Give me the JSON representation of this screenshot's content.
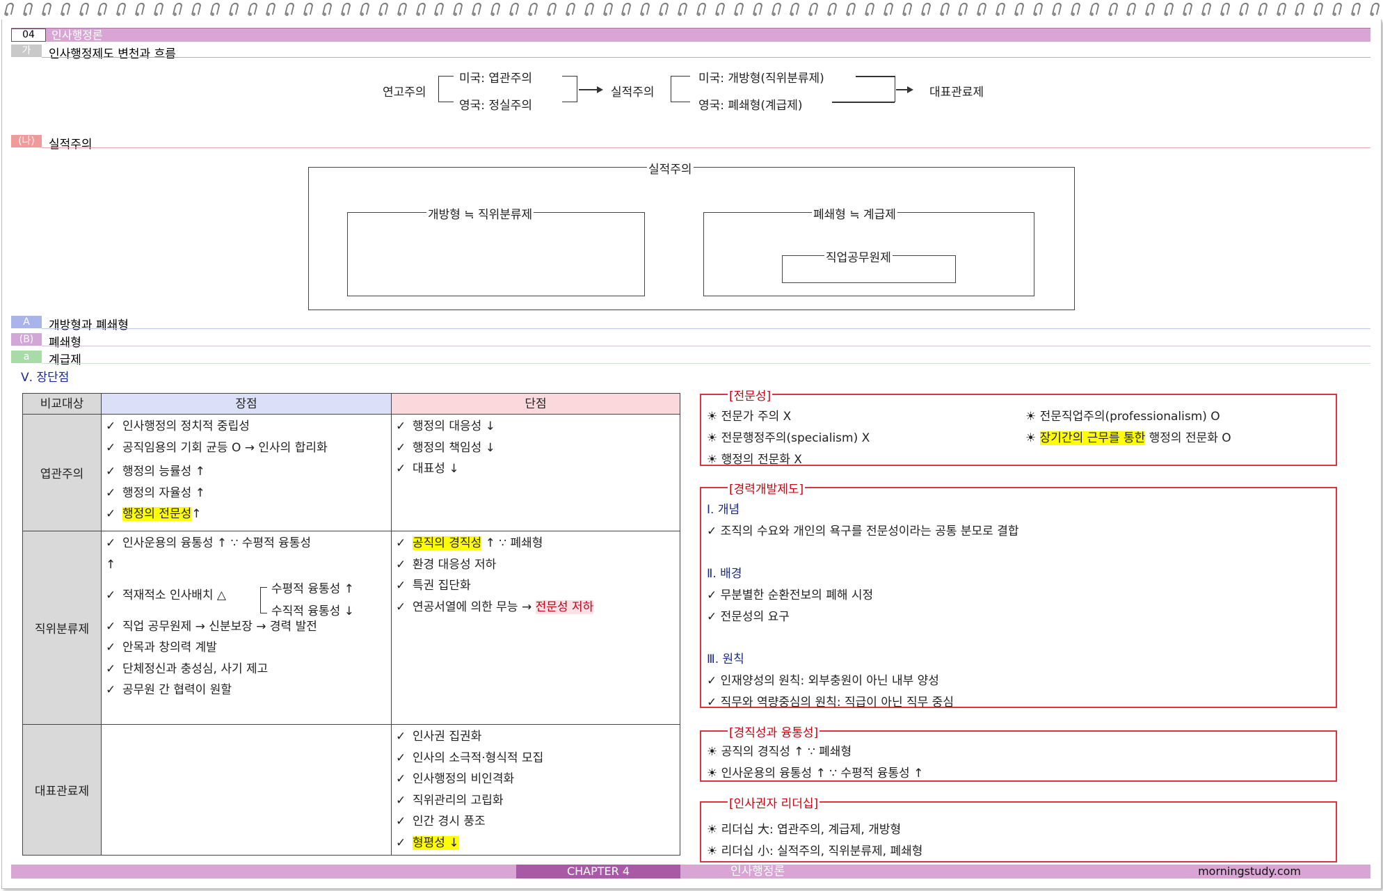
{
  "header": {
    "chapter_num": "04",
    "chapter_title": "인사행정론"
  },
  "section_ga": {
    "tag": "가",
    "title": "인사행정제도 변천과 흐름"
  },
  "flow": {
    "start": "연고주의",
    "us_patronage": "미국: 엽관주의",
    "uk_patronage": "영국: 정실주의",
    "middle": "실적주의",
    "us_open": "미국: 개방형(직위분류제)",
    "uk_closed": "영국: 폐쇄형(계급제)",
    "end": "대표관료제"
  },
  "section_na": {
    "tag": "(나)",
    "title": "실적주의"
  },
  "merit_diagram": {
    "outer": "실적주의",
    "left": "개방형 ≒ 직위분류제",
    "right": "폐쇄형 ≒ 계급제",
    "inner": "직업공무원제"
  },
  "section_a": {
    "tag": "A",
    "title": "개방형과 폐쇄형"
  },
  "section_b": {
    "tag": "(B)",
    "title": "폐쇄형"
  },
  "section_c": {
    "tag": "a",
    "title": "계급제"
  },
  "pros_cons_heading": "Ⅴ. 장단점",
  "table": {
    "headers": [
      "비교대상",
      "장점",
      "단점"
    ],
    "rows": [
      {
        "label": "엽관주의",
        "pros": [
          {
            "pre": "인사행정의 정치적 중립성",
            "hl": "",
            "post": ""
          },
          {
            "pre": "공직임용의 기회 균등 O → 인사의 합리화",
            "hl": "",
            "post": ""
          },
          {
            "pre": "행정의 능률성 ↑",
            "hl": "",
            "post": ""
          },
          {
            "pre": "행정의 자율성 ↑",
            "hl": "",
            "post": ""
          },
          {
            "pre": "",
            "hl": "행정의 전문성",
            "post": "↑"
          }
        ],
        "cons": [
          {
            "pre": "행정의 대응성 ↓",
            "hl": "",
            "post": ""
          },
          {
            "pre": "행정의 책임성 ↓",
            "hl": "",
            "post": ""
          },
          {
            "pre": "대표성 ↓",
            "hl": "",
            "post": ""
          }
        ]
      },
      {
        "label": "직위분류제",
        "pros": [
          {
            "pre": "인사운용의 융통성 ↑ ∵ 수평적 융통성",
            "hl": "",
            "post": ""
          },
          {
            "pre": "↑",
            "hl": "",
            "post": ""
          },
          {
            "pre": "적재적소 인사배치 △",
            "hl": "",
            "post": ""
          },
          {
            "pre": "직업 공무원제 → 신분보장 → 경력 발전",
            "hl": "",
            "post": ""
          },
          {
            "pre": "안목과 창의력 계발",
            "hl": "",
            "post": ""
          },
          {
            "pre": "단체정신과 충성심, 사기 제고",
            "hl": "",
            "post": ""
          },
          {
            "pre": "공무원 간 협력이 원할",
            "hl": "",
            "post": ""
          }
        ],
        "branch": [
          "수평적 융통성 ↑",
          "수직적 융통성 ↓"
        ],
        "cons": [
          {
            "pre": "",
            "hl": "공직의 경직성",
            "post": " ↑ ∵ 폐쇄형"
          },
          {
            "pre": "환경 대응성 저하",
            "hl": "",
            "post": ""
          },
          {
            "pre": "특권 집단화",
            "hl": "",
            "post": ""
          },
          {
            "pre": "연공서열에 의한 무능 → ",
            "hl2": "전문성 저하",
            "post": ""
          }
        ]
      },
      {
        "label": "대표관료제",
        "pros": [],
        "cons": [
          {
            "pre": "인사권 집권화",
            "hl": "",
            "post": ""
          },
          {
            "pre": "인사의 소극적·형식적 모집",
            "hl": "",
            "post": ""
          },
          {
            "pre": "인사행정의 비인격화",
            "hl": "",
            "post": ""
          },
          {
            "pre": "직위관리의 고립화",
            "hl": "",
            "post": ""
          },
          {
            "pre": "인간 경시 풍조",
            "hl": "",
            "post": ""
          },
          {
            "pre": "",
            "hl": "형평성 ↓",
            "post": ""
          }
        ]
      }
    ]
  },
  "box_expertise": {
    "title": "[전문성]",
    "left": [
      "전문가 주의 X",
      "전문행정주의(specialism) X",
      "행정의 전문화 X"
    ],
    "right1": "전문직업주의(professionalism) O",
    "right2_hl": "장기간의 근무를 통한",
    "right2_post": " 행정의 전문화 O"
  },
  "box_career": {
    "title": "[경력개발제도]",
    "h1": "Ⅰ. 개념",
    "c1": "조직의 수요와 개인의 욕구를 전문성이라는 공통 분모로 결합",
    "h2": "Ⅱ. 배경",
    "c2a": "무분별한 순환전보의 폐해 시정",
    "c2b": "전문성의 요구",
    "h3": "Ⅲ. 원칙",
    "c3a": "인재양성의 원칙: 외부충원이 아닌 내부 양성",
    "c3b": "직무와 역량중심의 원칙: 직급이 아닌 직무 중심"
  },
  "box_rigidity": {
    "title": "[경직성과 융통성]",
    "l1": "공직의 경직성 ↑ ∵ 폐쇄형",
    "l2": "인사운용의 융통성 ↑ ∵ 수평적 융통성 ↑"
  },
  "box_leadership": {
    "title": "[인사권자 리더십]",
    "l1": "리더십 大: 엽관주의, 계급제, 개방형",
    "l2": "리더십 小: 실적주의, 직위분류제, 폐쇄형"
  },
  "footer": {
    "chapter": "CHAPTER 4",
    "title": "인사행정론",
    "site": "morningstudy.com"
  },
  "colors": {
    "header": "#d8a5d5",
    "accent_red": "#e2323f",
    "highlight": "#ffff00",
    "footer_chapter": "#a85aa6"
  }
}
